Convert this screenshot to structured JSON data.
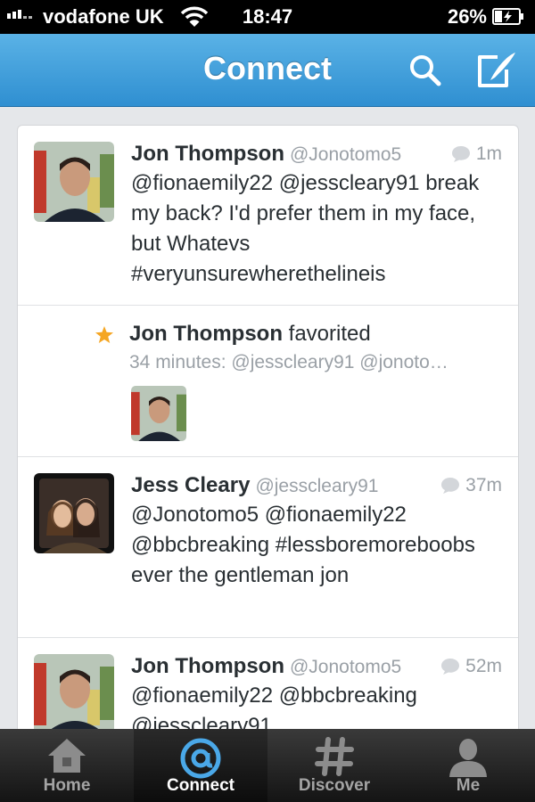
{
  "status": {
    "carrier": "vodafone UK",
    "time": "18:47",
    "battery": "26%"
  },
  "nav": {
    "title": "Connect",
    "search_icon": "search-icon",
    "compose_icon": "compose-icon"
  },
  "feed": [
    {
      "kind": "tweet",
      "name": "Jon Thompson",
      "handle": "@Jonotomo5",
      "time": "1m",
      "text": "@fionaemily22 @jesscleary91 break my back? I'd prefer them in my face, but Whatevs #veryunsurewherethelineis"
    },
    {
      "kind": "favorite",
      "name": "Jon Thompson",
      "action": "favorited",
      "detail": "34 minutes: @jesscleary91 @jonoto…"
    },
    {
      "kind": "tweet",
      "name": "Jess Cleary",
      "handle": "@jesscleary91",
      "time": "37m",
      "text": "@Jonotomo5 @fionaemily22 @bbcbreaking #lessboremoreboobs ever the gentleman jon"
    },
    {
      "kind": "tweet",
      "name": "Jon Thompson",
      "handle": "@Jonotomo5",
      "time": "52m",
      "text": "@fionaemily22 @bbcbreaking @jesscleary91"
    }
  ],
  "tabs": [
    {
      "label": "Home",
      "icon": "home-icon"
    },
    {
      "label": "Connect",
      "icon": "at-icon"
    },
    {
      "label": "Discover",
      "icon": "hash-icon"
    },
    {
      "label": "Me",
      "icon": "person-icon"
    }
  ],
  "colors": {
    "nav_top": "#5ab2e6",
    "nav_bottom": "#2f8fd1",
    "star": "#f5a623",
    "muted": "#9aa0a6"
  }
}
